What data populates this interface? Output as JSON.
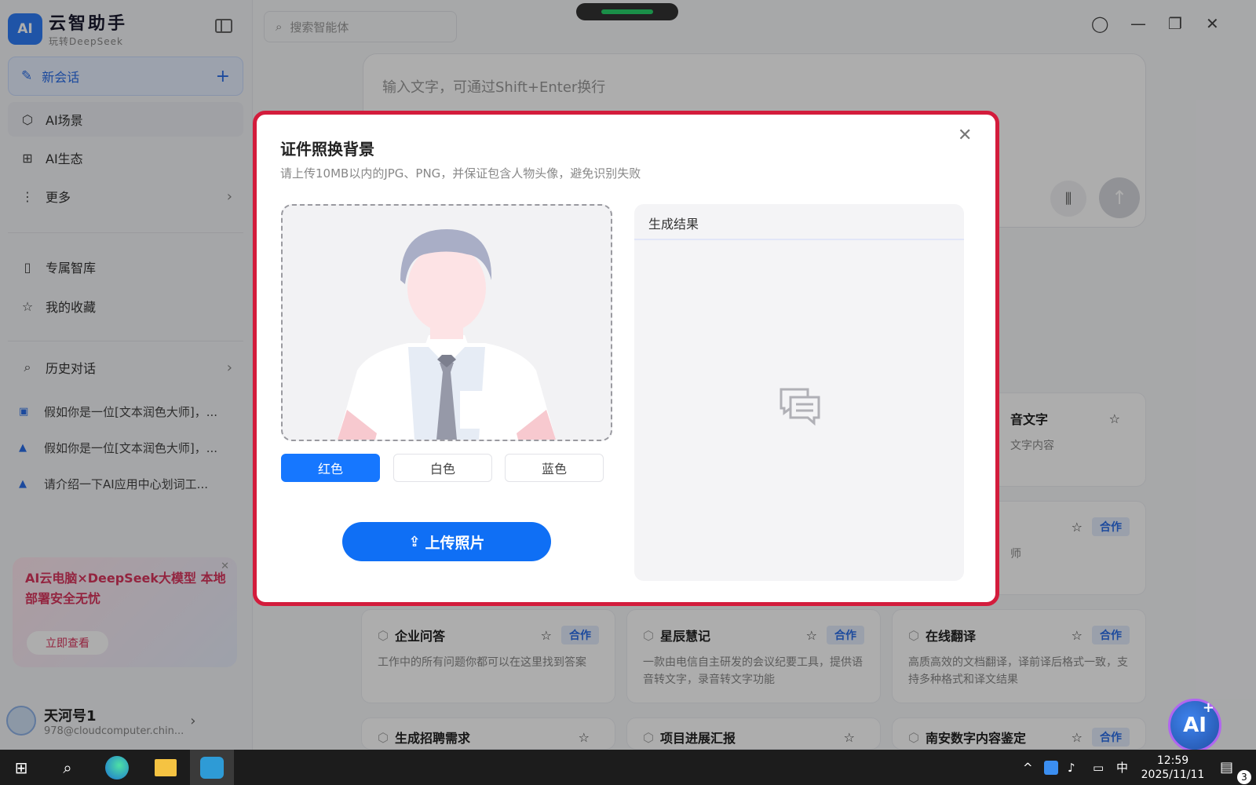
{
  "app": {
    "title": "云智助手",
    "subtitle": "玩转DeepSeek",
    "logo_text": "AI"
  },
  "sidebar": {
    "new_chat": "新会话",
    "nav": [
      {
        "label": "AI场景",
        "icon": "cube-icon"
      },
      {
        "label": "AI生态",
        "icon": "grid-icon"
      },
      {
        "label": "更多",
        "icon": "more-icon"
      }
    ],
    "library": [
      {
        "label": "专属智库",
        "icon": "book-icon"
      },
      {
        "label": "我的收藏",
        "icon": "star-icon"
      }
    ],
    "history_label": "历史对话",
    "history": [
      "假如你是一位[文本润色大师]，...",
      "假如你是一位[文本润色大师]，...",
      "请介绍一下AI应用中心划词工..."
    ],
    "promo": {
      "text": "AI云电脑×DeepSeek大模型 本地部署安全无忧",
      "button": "立即查看"
    },
    "user": {
      "name": "天河号1",
      "email": "978@cloudcomputer.chin..."
    }
  },
  "topbar": {
    "search_placeholder": "搜索智能体"
  },
  "composer": {
    "placeholder": "输入文字，可通过Shift+Enter换行"
  },
  "cards": [
    {
      "title": "企业问答",
      "badge": "合作",
      "desc": "工作中的所有问题你都可以在这里找到答案"
    },
    {
      "title": "星辰慧记",
      "badge": "合作",
      "desc": "一款由电信自主研发的会议纪要工具，提供语音转文字，录音转文字功能"
    },
    {
      "title": "在线翻译",
      "badge": "合作",
      "desc": "高质高效的文档翻译，译前译后格式一致，支持多种格式和译文结果"
    },
    {
      "title": "音文字",
      "badge": "",
      "desc": "文字内容"
    },
    {
      "title": "",
      "badge": "合作",
      "desc": "师"
    },
    {
      "title": "生成招聘需求",
      "badge": "",
      "desc": ""
    },
    {
      "title": "项目进展汇报",
      "badge": "",
      "desc": ""
    },
    {
      "title": "南安数字内容鉴定",
      "badge": "合作",
      "desc": ""
    }
  ],
  "modal": {
    "title": "证件照换背景",
    "subtitle": "请上传10MB以内的JPG、PNG，并保证包含人物头像，避免识别失败",
    "colors": [
      {
        "label": "红色",
        "active": true
      },
      {
        "label": "白色",
        "active": false
      },
      {
        "label": "蓝色",
        "active": false
      }
    ],
    "upload_label": "上传照片",
    "result_title": "生成结果"
  },
  "fab_label": "AI",
  "taskbar": {
    "time": "12:59",
    "date": "2025/11/11",
    "ime": "中",
    "notifications": "3"
  },
  "colors": {
    "accent": "#1677ff",
    "modal_border": "#d31c3c",
    "promo": "#d9365e"
  }
}
